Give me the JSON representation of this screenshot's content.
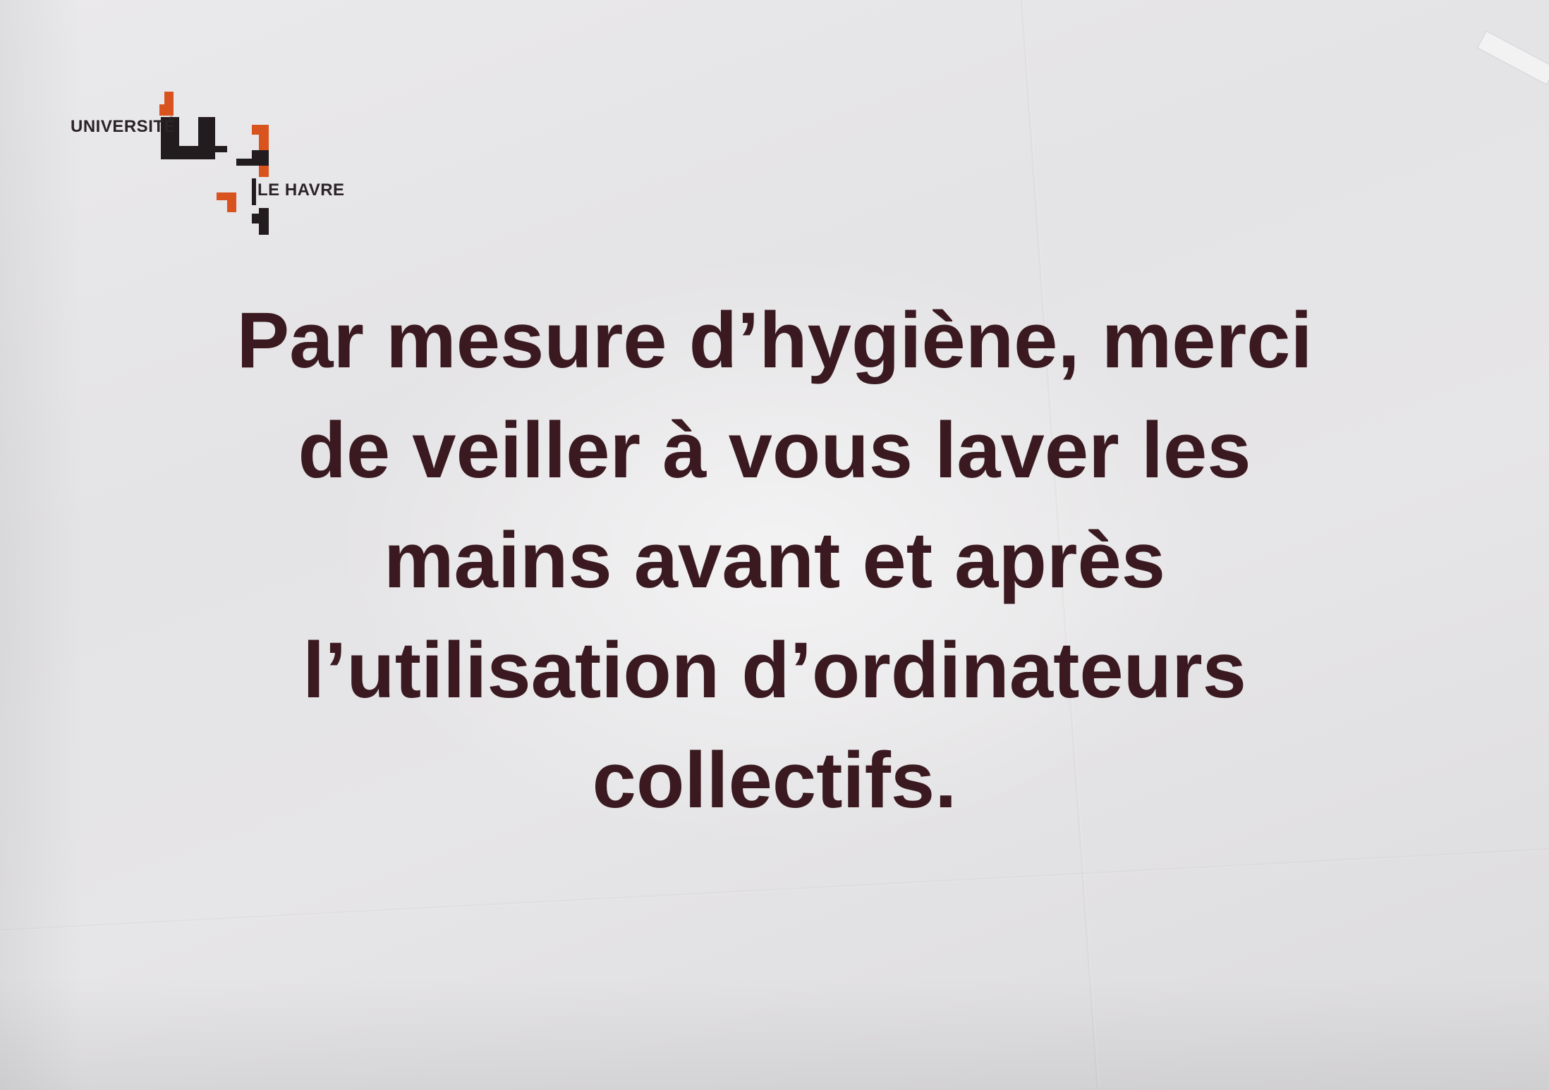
{
  "logo": {
    "top_text": "UNIVERSITÉ",
    "bottom_text": "LE HAVRE",
    "colors": {
      "dark": "#231c1e",
      "accent": "#d9531e"
    }
  },
  "notice": {
    "lines": [
      "Par mesure d’hygiène, merci",
      "de veiller à vous laver les",
      "mains avant et après",
      "l’utilisation d’ordinateurs",
      "collectifs."
    ],
    "text_color": "#3a1a20"
  },
  "paper_color": "#e6e5e7"
}
